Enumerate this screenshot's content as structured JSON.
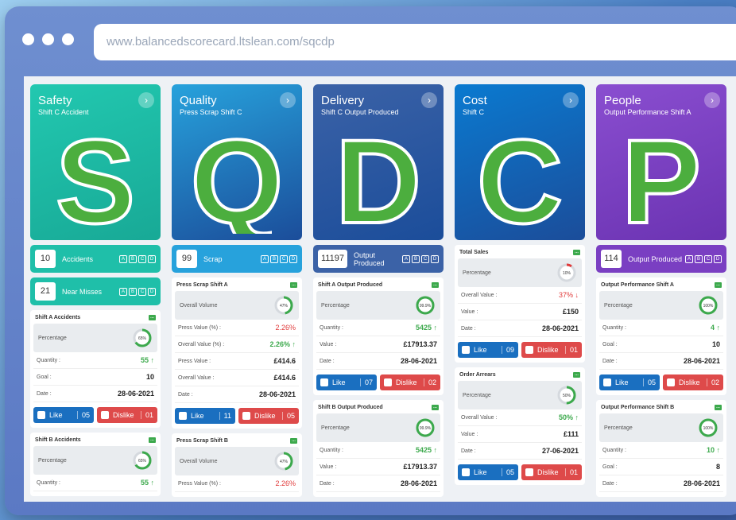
{
  "browser": {
    "url": "www.balancedscorecard.ltslean.com/sqcdp"
  },
  "colors": {
    "safety": "#1fbfa9",
    "quality": "#27a2dc",
    "delivery": "#3b62a7",
    "cost": "#0a7ad0",
    "people": "#7a3fc2",
    "green": "#3ca94c",
    "red": "#e03a3a",
    "like": "#1a6fc0",
    "dislike": "#de4a4a"
  },
  "columns": [
    {
      "title": "Safety",
      "subtitle": "Shift C Accident",
      "letter": "S",
      "metrics": [
        {
          "value": "10",
          "label": "Accidents"
        },
        {
          "value": "21",
          "label": "Near Misses"
        }
      ],
      "cards": [
        {
          "title": "Shift A Accidents",
          "pct_label": "Percentage",
          "pct": "65%",
          "rows": [
            [
              "Quantity :",
              "55 ↑"
            ],
            [
              "Goal :",
              "10"
            ],
            [
              "Date :",
              "28-06-2021"
            ]
          ],
          "like": "05",
          "dislike": "01"
        },
        {
          "title": "Shift B Accidents",
          "pct_label": "Percentage",
          "pct": "65%",
          "rows": [
            [
              "Quantity :",
              "55 ↑"
            ]
          ]
        }
      ]
    },
    {
      "title": "Quality",
      "subtitle": "Press Scrap Shift C",
      "letter": "Q",
      "metrics": [
        {
          "value": "99",
          "label": "Scrap"
        }
      ],
      "cards": [
        {
          "title": "Press Scrap Shift A",
          "pct_label": "Overall Volume",
          "pct": "47%",
          "rows": [
            [
              "Press Value (%) :",
              "2.26%"
            ],
            [
              "Overall Value (%) :",
              "2.26% ↑"
            ],
            [
              "Press Value :",
              "£414.6"
            ],
            [
              "Overall Value :",
              "£414.6"
            ],
            [
              "Date :",
              "28-06-2021"
            ]
          ],
          "like": "11",
          "dislike": "05"
        },
        {
          "title": "Press Scrap Shift B",
          "pct_label": "Overall Volume",
          "pct": "47%",
          "rows": [
            [
              "Press Value (%) :",
              "2.26%"
            ]
          ]
        }
      ]
    },
    {
      "title": "Delivery",
      "subtitle": "Shift C Output Produced",
      "letter": "D",
      "metrics": [
        {
          "value": "11197",
          "label": "Output Produced"
        }
      ],
      "cards": [
        {
          "title": "Shift A Output Produced",
          "pct_label": "Percentage",
          "pct": "99.9%",
          "rows": [
            [
              "Quantity :",
              "5425 ↑"
            ],
            [
              "Value :",
              "£17913.37"
            ],
            [
              "Date :",
              "28-06-2021"
            ]
          ],
          "like": "07",
          "dislike": "02"
        },
        {
          "title": "Shift B Output Produced",
          "pct_label": "Percentage",
          "pct": "99.9%",
          "rows": [
            [
              "Quantity :",
              "5425 ↑"
            ],
            [
              "Value :",
              "£17913.37"
            ],
            [
              "Date :",
              "28-06-2021"
            ]
          ]
        }
      ]
    },
    {
      "title": "Cost",
      "subtitle": "Shift C",
      "letter": "C",
      "metrics": [],
      "cards": [
        {
          "title": "Total Sales",
          "pct_label": "Percentage",
          "pct": "10%",
          "rows": [
            [
              "Overall Value :",
              "37% ↓"
            ],
            [
              "Value :",
              "£150"
            ],
            [
              "Date :",
              "28-06-2021"
            ]
          ],
          "like": "09",
          "dislike": "01"
        },
        {
          "title": "Order Arrears",
          "pct_label": "Percentage",
          "pct": "50%",
          "rows": [
            [
              "Overall Value :",
              "50% ↑"
            ],
            [
              "Value :",
              "£111"
            ],
            [
              "Date :",
              "27-06-2021"
            ]
          ],
          "like": "05",
          "dislike": "01"
        }
      ]
    },
    {
      "title": "People",
      "subtitle": "Output Performance Shift A",
      "letter": "P",
      "metrics": [
        {
          "value": "114",
          "label": "Output Produced"
        }
      ],
      "cards": [
        {
          "title": "Output Performance Shift A",
          "pct_label": "Percentage",
          "pct": "100%",
          "rows": [
            [
              "Quantity :",
              "4 ↑"
            ],
            [
              "Goal :",
              "10"
            ],
            [
              "Date :",
              "28-06-2021"
            ]
          ],
          "like": "05",
          "dislike": "02"
        },
        {
          "title": "Output Performance Shift B",
          "pct_label": "Percentage",
          "pct": "100%",
          "rows": [
            [
              "Quantity :",
              "10 ↑"
            ],
            [
              "Goal :",
              "8"
            ],
            [
              "Date :",
              "28-06-2021"
            ]
          ]
        }
      ]
    }
  ],
  "buttons": {
    "like": "Like",
    "dislike": "Dislike",
    "go": "›"
  },
  "abcd": [
    "A",
    "B",
    "C",
    "D"
  ]
}
